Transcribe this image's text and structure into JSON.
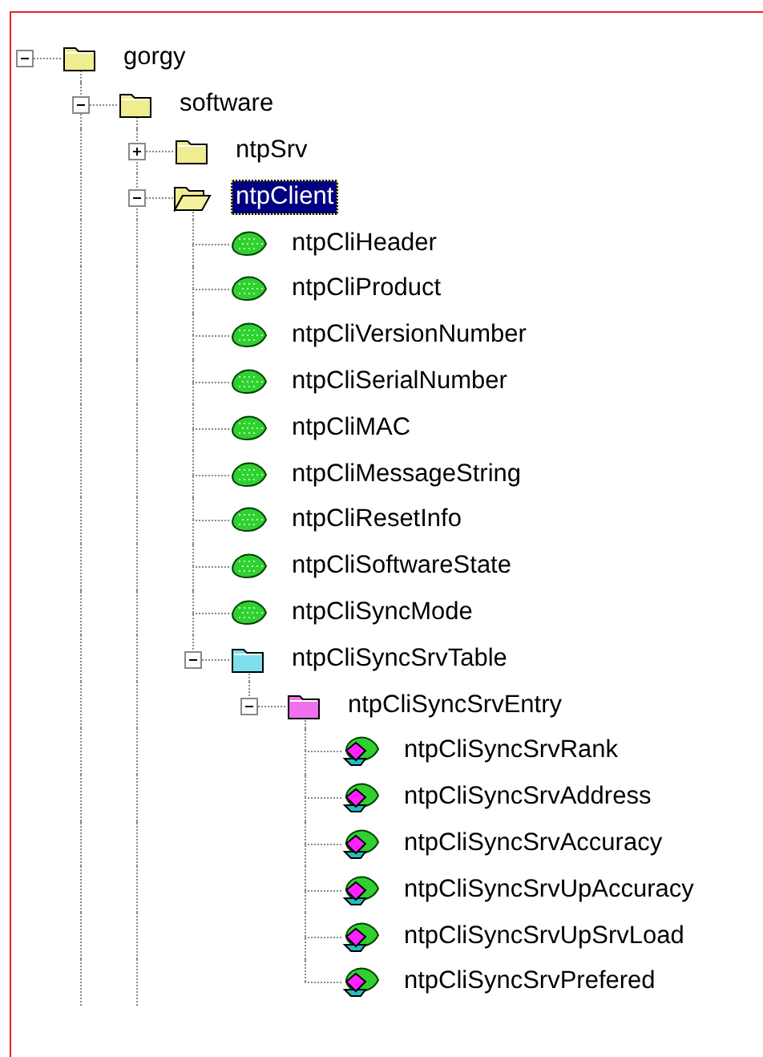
{
  "tree": [
    {
      "label": "gorgy",
      "kind": "folder",
      "expanded": true,
      "selected": false,
      "more_children_below": true,
      "children": [
        {
          "label": "software",
          "kind": "folder",
          "expanded": true,
          "selected": false,
          "more_children_below": true,
          "children": [
            {
              "label": "ntpSrv",
              "kind": "folder",
              "expanded": false,
              "selected": false
            },
            {
              "label": "ntpClient",
              "kind": "folder_open",
              "expanded": true,
              "selected": true,
              "children": [
                {
                  "label": "ntpCliHeader",
                  "kind": "scalar",
                  "selected": false
                },
                {
                  "label": "ntpCliProduct",
                  "kind": "scalar",
                  "selected": false
                },
                {
                  "label": "ntpCliVersionNumber",
                  "kind": "scalar",
                  "selected": false
                },
                {
                  "label": "ntpCliSerialNumber",
                  "kind": "scalar",
                  "selected": false
                },
                {
                  "label": "ntpCliMAC",
                  "kind": "scalar",
                  "selected": false
                },
                {
                  "label": "ntpCliMessageString",
                  "kind": "scalar",
                  "selected": false
                },
                {
                  "label": "ntpCliResetInfo",
                  "kind": "scalar",
                  "selected": false
                },
                {
                  "label": "ntpCliSoftwareState",
                  "kind": "scalar",
                  "selected": false
                },
                {
                  "label": "ntpCliSyncMode",
                  "kind": "scalar",
                  "selected": false
                },
                {
                  "label": "ntpCliSyncSrvTable",
                  "kind": "table",
                  "expanded": true,
                  "selected": false,
                  "children": [
                    {
                      "label": "ntpCliSyncSrvEntry",
                      "kind": "entry",
                      "expanded": true,
                      "selected": false,
                      "children": [
                        {
                          "label": "ntpCliSyncSrvRank",
                          "kind": "column",
                          "selected": false
                        },
                        {
                          "label": "ntpCliSyncSrvAddress",
                          "kind": "column",
                          "selected": false
                        },
                        {
                          "label": "ntpCliSyncSrvAccuracy",
                          "kind": "column",
                          "selected": false
                        },
                        {
                          "label": "ntpCliSyncSrvUpAccuracy",
                          "kind": "column",
                          "selected": false
                        },
                        {
                          "label": "ntpCliSyncSrvUpSrvLoad",
                          "kind": "column",
                          "selected": false
                        },
                        {
                          "label": "ntpCliSyncSrvPrefered",
                          "kind": "column",
                          "selected": false
                        }
                      ]
                    }
                  ]
                }
              ]
            }
          ]
        }
      ]
    }
  ]
}
